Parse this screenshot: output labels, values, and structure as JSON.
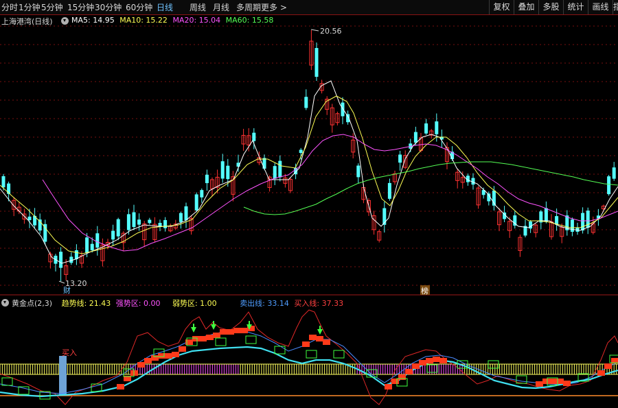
{
  "toolbar": {
    "periods": [
      "分时",
      "1分钟",
      "5分钟",
      "15分钟",
      "30分钟",
      "60分钟",
      "日线",
      "周线",
      "月线",
      "多周期",
      "更多"
    ],
    "active_period": "日线",
    "more_glyph": ">",
    "right_buttons": [
      "复权",
      "叠加",
      "多股",
      "统计",
      "画线",
      "指"
    ]
  },
  "main_chart": {
    "title": "上海港湾(日线)",
    "ma5": "MA5: 14.95",
    "ma10": "MA10: 15.22",
    "ma20": "MA20: 15.04",
    "ma60": "MA60: 15.58",
    "high_label": "20.56",
    "low_label": "13.20",
    "marker_cai": "财",
    "marker_bang": "榜",
    "colors": {
      "up": "#ff3232",
      "down": "#54ffff",
      "ma5": "#ffffff",
      "ma10": "#ffff54",
      "ma20": "#ff54ff",
      "ma60": "#54ff54"
    }
  },
  "indicator": {
    "title": "黄金点(2,3)",
    "trend": "趋势线: 21.43",
    "strong": "强势区: 0.00",
    "weak": "弱势区: 1.00",
    "sell": "卖出线: 33.14",
    "buy": "买入线: 37.33",
    "buy_signal": "买入"
  },
  "chart_data": [
    {
      "type": "candlestick",
      "title": "上海港湾(日线)",
      "ylim": [
        13.2,
        20.56
      ],
      "highest": 20.56,
      "lowest": 13.2,
      "series": [
        {
          "name": "MA5",
          "last": 14.95
        },
        {
          "name": "MA10",
          "last": 15.22
        },
        {
          "name": "MA20",
          "last": 15.04
        },
        {
          "name": "MA60",
          "last": 15.58
        }
      ]
    },
    {
      "type": "line",
      "title": "黄金点(2,3)",
      "series": [
        {
          "name": "趋势线",
          "last": 21.43
        },
        {
          "name": "强势区",
          "last": 0.0
        },
        {
          "name": "弱势区",
          "last": 1.0
        },
        {
          "name": "卖出线",
          "last": 33.14
        },
        {
          "name": "买入线",
          "last": 37.33
        }
      ]
    }
  ]
}
